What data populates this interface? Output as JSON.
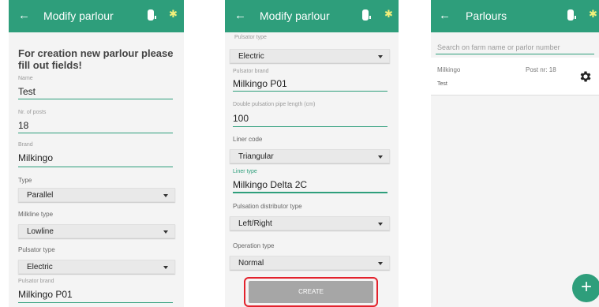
{
  "screen1": {
    "title": "Modify parlour",
    "heading": "For creation new parlour please fill out fields!",
    "fields": [
      {
        "label": "Name",
        "value": "Test"
      },
      {
        "label": "Nr. of posts",
        "value": "18"
      },
      {
        "label": "Brand",
        "value": "Milkingo"
      }
    ],
    "selects": [
      {
        "label": "Type",
        "value": "Parallel"
      },
      {
        "label": "Milkline type",
        "value": "Lowline"
      },
      {
        "label": "Pulsator type",
        "value": "Electric"
      }
    ],
    "pulsator_brand": {
      "label": "Pulsator brand",
      "value": "Milkingo P01"
    }
  },
  "screen2": {
    "title": "Modify parlour",
    "pulsator_type_label": "Pulsator type",
    "pulsator_type": "Electric",
    "pulsator_brand": {
      "label": "Pulsator brand",
      "value": "Milkingo P01"
    },
    "double_pipe": {
      "label": "Double pulsation pipe length (cm)",
      "value": "100"
    },
    "liner_code": {
      "label": "Liner code",
      "value": "Triangular"
    },
    "liner_type": {
      "label": "Liner type",
      "value": "Milkingo Delta 2C"
    },
    "distributor": {
      "label": "Pulsation distributor type",
      "value": "Left/Right"
    },
    "operation": {
      "label": "Operation type",
      "value": "Normal"
    },
    "create_label": "CREATE"
  },
  "screen3": {
    "title": "Parlours",
    "search_placeholder": "Search on farm name or parlor number",
    "item": {
      "name": "Milkingo",
      "posts": "Post nr: 18",
      "sub": "Test"
    },
    "fab_label": "+"
  },
  "icons": {
    "back": "arrow-left-icon",
    "device": "device-battery-icon",
    "bluetooth": "bluetooth-icon",
    "settings": "gear-icon",
    "add": "plus-icon"
  },
  "colors": {
    "primary": "#2e9e7b",
    "highlight": "#e3222c",
    "bluetooth": "#f4f07a"
  }
}
